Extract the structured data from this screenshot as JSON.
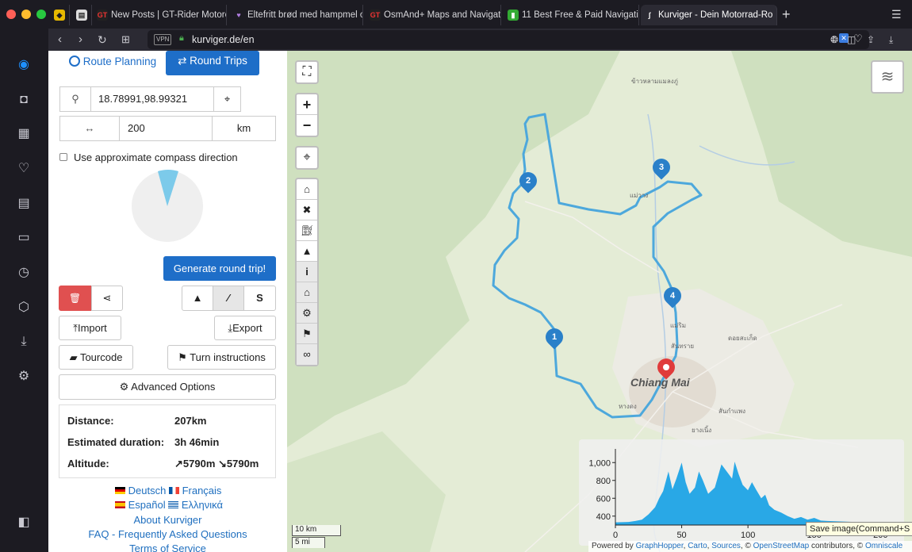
{
  "browser": {
    "tabs": [
      {
        "label": "",
        "icon": "shield-icon"
      },
      {
        "label": "",
        "icon": "document-icon"
      },
      {
        "label": "New Posts | GT-Rider Motorc",
        "icon": "GT"
      },
      {
        "label": "Eltefritt brød med hampmel o",
        "icon": "heart-icon"
      },
      {
        "label": "OsmAnd+ Maps and Navigati",
        "icon": "GT"
      },
      {
        "label": "11 Best Free & Paid Navigatio",
        "icon": "battery-icon"
      },
      {
        "label": "Kurviger - Dein Motorrad-Ro",
        "icon": "kurviger-icon"
      }
    ],
    "new_tab": "+",
    "url": "kurviger.de/en",
    "vpn": "VPN",
    "badge_count": "1"
  },
  "planner": {
    "mode_tabs": {
      "route": "Route Planning",
      "round": "Round Trips"
    },
    "start_value": "18.78991,98.99321",
    "distance_value": "200",
    "distance_unit": "km",
    "compass_label": "Use approximate compass direction",
    "generate_label": "Generate round trip!",
    "import_label": "Import",
    "export_label": "Export",
    "tourcode_label": "Tourcode",
    "turn_label": "Turn instructions",
    "advanced_label": "Advanced Options",
    "stats": [
      {
        "label": "Distance:",
        "value": "207km"
      },
      {
        "label": "Estimated duration:",
        "value": "3h 46min"
      },
      {
        "label": "Altitude:",
        "value": "↗5790m ↘5790m"
      }
    ],
    "languages": [
      "Deutsch",
      "Français",
      "Español",
      "Ελληνικά"
    ],
    "footer_links": [
      "About Kurviger",
      "FAQ - Frequently Asked Questions",
      "Terms of Service"
    ]
  },
  "map": {
    "city": "Chiang Mai",
    "waypoints": [
      "1",
      "2",
      "3",
      "4"
    ],
    "scale": {
      "km": "10 km",
      "mi": "5 mi"
    },
    "attribution": {
      "prefix": "Powered by ",
      "links": [
        "GraphHopper",
        "Carto",
        "Sources",
        "OpenStreetMap"
      ],
      "mid": " contributors, © ",
      "end": "Omniscale"
    },
    "save_tooltip": "Save image(Command+S",
    "labels": [
      "สันทราย",
      "ยางเนิ้ง",
      "สันกำแพง",
      "แม่ริม",
      "ดอยสะเก็ด",
      "ข้าวหลามแมลงภู่",
      "แม่วาง",
      "หางดง"
    ]
  },
  "chart_data": {
    "type": "area",
    "x_unit": "km",
    "xlim": [
      0,
      207
    ],
    "ylim": [
      300,
      1100
    ],
    "xticks": [
      "0",
      "50",
      "100",
      "150",
      "200"
    ],
    "yticks": [
      "1,000",
      "800",
      "600",
      "400"
    ],
    "x": [
      0,
      10,
      15,
      20,
      25,
      30,
      33,
      36,
      40,
      43,
      46,
      50,
      53,
      56,
      60,
      63,
      66,
      70,
      75,
      80,
      85,
      88,
      90,
      93,
      96,
      100,
      103,
      106,
      110,
      113,
      116,
      120,
      125,
      130,
      135,
      140,
      145,
      150,
      155,
      160,
      170,
      180,
      190,
      200,
      207
    ],
    "values": [
      330,
      335,
      345,
      360,
      420,
      500,
      600,
      680,
      900,
      700,
      820,
      1000,
      780,
      650,
      720,
      900,
      800,
      650,
      720,
      980,
      880,
      820,
      1010,
      870,
      750,
      690,
      780,
      700,
      600,
      640,
      520,
      470,
      440,
      400,
      370,
      390,
      360,
      380,
      350,
      345,
      340,
      335,
      335,
      330,
      330
    ],
    "color": "#29a8e6"
  },
  "colors": {
    "accent": "#1e6ec8",
    "route": "#4da8dc",
    "danger": "#e05050"
  }
}
